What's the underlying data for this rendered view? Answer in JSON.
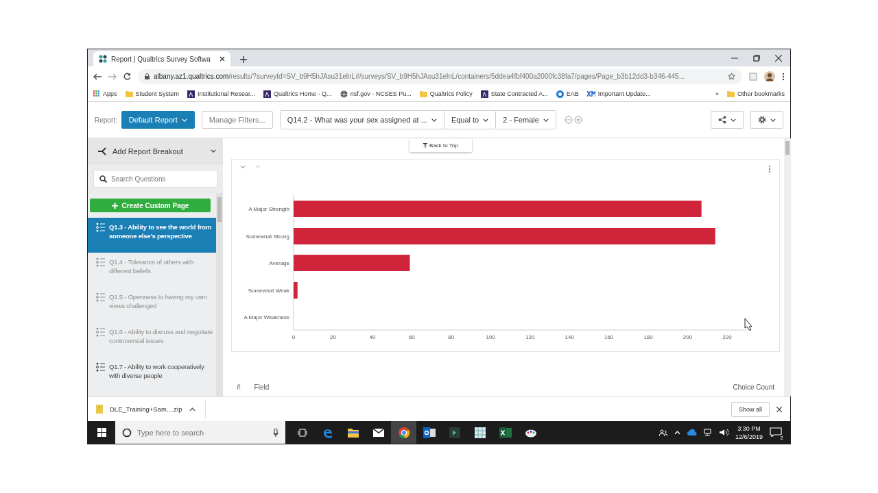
{
  "browser": {
    "tab_title": "Report | Qualtrics Survey Softwa",
    "url_host": "albany.az1.qualtrics.com",
    "url_path": "/results/?surveyId=SV_b9H5hJAsu31elnL#/surveys/SV_b9H5hJAsu31elnL/containers/5ddea4fbf400a2000fc38fa7/pages/Page_b3b12dd3-b346-445...",
    "bookmarks": [
      {
        "kind": "apps",
        "label": "Apps"
      },
      {
        "kind": "folder",
        "label": "Student System"
      },
      {
        "kind": "site",
        "label": "Institutional Resear..."
      },
      {
        "kind": "site",
        "label": "Qualtrics Home - Q..."
      },
      {
        "kind": "globe",
        "label": "nsf.gov - NCSES Pu..."
      },
      {
        "kind": "folder",
        "label": "Qualtrics Policy"
      },
      {
        "kind": "site",
        "label": "State Contracted A..."
      },
      {
        "kind": "circle",
        "label": "EAB"
      },
      {
        "kind": "xm",
        "label": "Important Update..."
      }
    ],
    "more": "»",
    "other_bookmarks": "Other bookmarks"
  },
  "toolbar": {
    "report_label": "Report:",
    "report": "Default Report",
    "manage_filters": "Manage Filters...",
    "filter_question": "Q14.2 - What was your sex assigned at ...",
    "filter_operator": "Equal to",
    "filter_value": "2 - Female"
  },
  "back_to_top": "Back to Top",
  "sidebar": {
    "breakout": "Add Report Breakout",
    "search_placeholder": "Search Questions",
    "create_page": "Create Custom Page",
    "questions": [
      {
        "label": "Q1.3 - Ability to see the world from someone else's perspective",
        "selected": true,
        "disabled": false
      },
      {
        "label": "Q1.4 - Tolerance of others with different beliefs",
        "selected": false,
        "disabled": true
      },
      {
        "label": "Q1.5 - Openness to having my own views challenged",
        "selected": false,
        "disabled": true
      },
      {
        "label": "Q1.6 - Ability to discuss and negotiate controversial issues",
        "selected": false,
        "disabled": true
      },
      {
        "label": "Q1.7 - Ability to work cooperatively with diverse people",
        "selected": false,
        "disabled": false
      }
    ]
  },
  "chart": {
    "chart_data": {
      "type": "bar",
      "orientation": "horizontal",
      "categories": [
        "A Major Strength",
        "Somewhat Strong",
        "Average",
        "Somewhat Weak",
        "A Major Weakness"
      ],
      "series": [
        {
          "color": "#d0243a",
          "values": [
            207,
            214,
            59,
            2,
            0
          ]
        }
      ],
      "xlim": [
        0,
        230
      ],
      "xticks": [
        0,
        20,
        40,
        60,
        80,
        100,
        120,
        140,
        160,
        180,
        200,
        220
      ]
    }
  },
  "table": {
    "columns": [
      "#",
      "Field",
      "Choice Count"
    ]
  },
  "download": {
    "file": "DLE_Training+Sam....zip",
    "show_all": "Show all"
  },
  "taskbar": {
    "search_placeholder": "Type here to search",
    "time": "3:30 PM",
    "date": "12/6/2019",
    "notifications": "2"
  }
}
